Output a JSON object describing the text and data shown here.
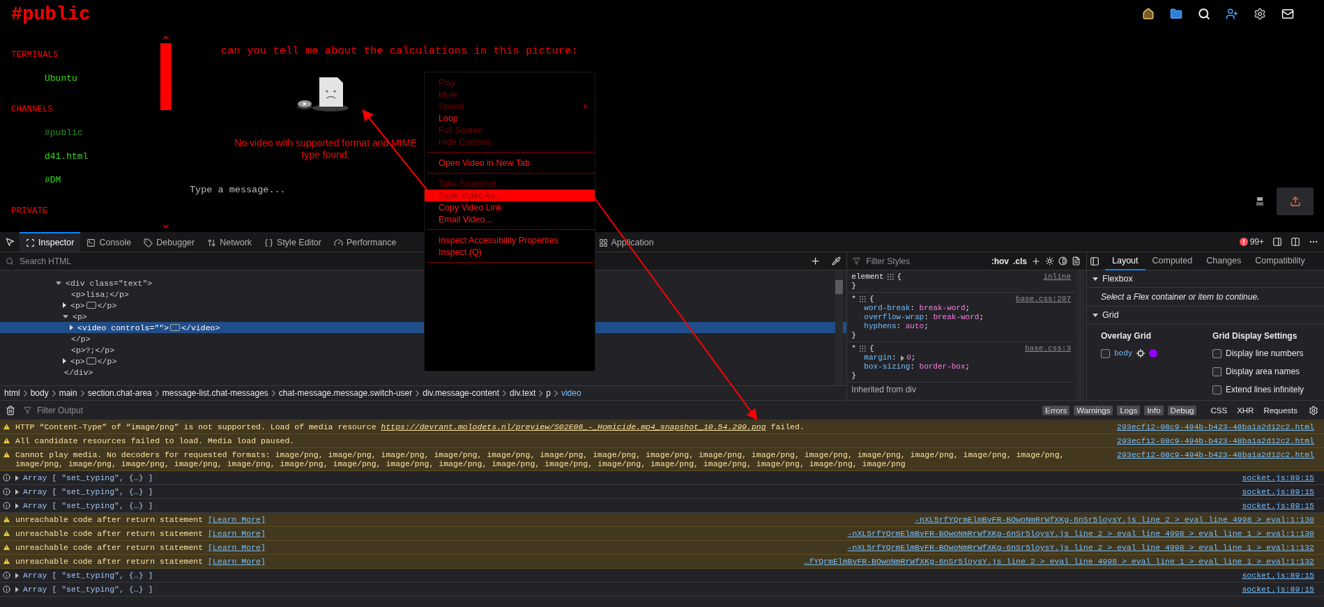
{
  "chat": {
    "sidebar": {
      "title": "#public",
      "sections": [
        {
          "heading": "TERMINALS",
          "items": [
            {
              "label": "Ubuntu",
              "selected": false
            }
          ]
        },
        {
          "heading": "CHANNELS",
          "items": [
            {
              "label": "#public",
              "selected": true
            },
            {
              "label": "d41.html",
              "selected": false
            },
            {
              "label": "#DM",
              "selected": false
            }
          ]
        },
        {
          "heading": "PRIVATE"
        }
      ]
    },
    "message": "can you tell me about the calculations in this picture:",
    "video_error": "No video with supported format and MIME type found.",
    "input": {
      "placeholder": "Type a message..."
    }
  },
  "context_menu": {
    "groups": [
      {
        "items": [
          {
            "label": "Play",
            "disabled": true,
            "selected": false,
            "submenu": false
          },
          {
            "label": "Mute",
            "disabled": true,
            "selected": false,
            "submenu": false
          },
          {
            "label": "Speed",
            "disabled": true,
            "selected": false,
            "submenu": true
          },
          {
            "label": "Loop",
            "disabled": false,
            "selected": false,
            "submenu": false
          },
          {
            "label": "Full Screen",
            "disabled": true,
            "selected": false,
            "submenu": false
          },
          {
            "label": "Hide Controls",
            "disabled": true,
            "selected": false,
            "submenu": false
          }
        ]
      },
      {
        "items": [
          {
            "label": "Open Video in New Tab",
            "disabled": false,
            "selected": false,
            "submenu": false
          }
        ]
      },
      {
        "items": [
          {
            "label": "Take Snapshot...",
            "disabled": true,
            "selected": false,
            "submenu": false
          },
          {
            "label": "Save Video As...",
            "disabled": false,
            "selected": true,
            "submenu": false
          },
          {
            "label": "Copy Video Link",
            "disabled": false,
            "selected": false,
            "submenu": false
          },
          {
            "label": "Email Video...",
            "disabled": false,
            "selected": false,
            "submenu": false
          }
        ]
      },
      {
        "items": [
          {
            "label": "Inspect Accessibility Properties",
            "disabled": false,
            "selected": false,
            "submenu": false
          },
          {
            "label": "Inspect (Q)",
            "disabled": false,
            "selected": false,
            "submenu": false
          }
        ]
      }
    ]
  },
  "devtools": {
    "tabs": [
      {
        "label": "Inspector",
        "selected": true
      },
      {
        "label": "Console",
        "selected": false
      },
      {
        "label": "Debugger",
        "selected": false
      },
      {
        "label": "Network",
        "selected": false
      },
      {
        "label": "Style Editor",
        "selected": false
      },
      {
        "label": "Performance",
        "selected": false
      },
      {
        "label": "Application",
        "selected": false
      }
    ],
    "error_count": "99+",
    "markup": {
      "search_placeholder": "Search HTML",
      "nodes": [
        {
          "kind": "element",
          "tag": "<div class=\"text\">",
          "close": "</div>",
          "expanded": true,
          "selected": false,
          "children": [
            {
              "kind": "text",
              "tag": "<p>lisa;</p>",
              "selected": false
            },
            {
              "kind": "element",
              "tag": "<p>",
              "close": "</p>",
              "expanded": false,
              "selected": false
            },
            {
              "kind": "element",
              "tag": "<p>",
              "close": "</p>",
              "expanded": true,
              "selected": false,
              "children": [
                {
                  "kind": "element",
                  "tag": "<video controls=\"\">",
                  "close": "</video>",
                  "expanded": false,
                  "selected": true
                }
              ]
            },
            {
              "kind": "text",
              "tag": "<p>?;</p>",
              "selected": false
            },
            {
              "kind": "element",
              "tag": "<p>",
              "close": "</p>",
              "expanded": false,
              "selected": false
            }
          ]
        }
      ],
      "breadcrumbs": [
        {
          "label": "html",
          "selected": false
        },
        {
          "label": "body",
          "selected": false
        },
        {
          "label": "main",
          "selected": false
        },
        {
          "label": "section.chat-area",
          "selected": false
        },
        {
          "label": "message-list.chat-messages",
          "selected": false
        },
        {
          "label": "chat-message.message.switch-user",
          "selected": false
        },
        {
          "label": "div.message-content",
          "selected": false
        },
        {
          "label": "div.text",
          "selected": false
        },
        {
          "label": "p",
          "selected": false
        },
        {
          "label": "video",
          "selected": true
        }
      ]
    },
    "rules": {
      "filter_placeholder": "Filter Styles",
      "toggles": [
        ":hov",
        ".cls"
      ],
      "rules": [
        {
          "selector": "element",
          "open": "{",
          "close": "}",
          "source": "inline"
        },
        {
          "selector": "*",
          "open": "{",
          "close": "}",
          "source": "base.css:207",
          "declarations": [
            {
              "property": "word-break",
              "colon": ":",
              "value": "break-word",
              "end": ";",
              "expandable": false
            },
            {
              "property": "overflow-wrap",
              "colon": ":",
              "value": "break-word",
              "end": ";",
              "expandable": false
            },
            {
              "property": "hyphens",
              "colon": ":",
              "value": "auto",
              "end": ";",
              "expandable": false
            }
          ]
        },
        {
          "selector": "*",
          "open": "{",
          "close": "}",
          "source": "base.css:3",
          "declarations": [
            {
              "property": "margin",
              "colon": ":",
              "value": "0",
              "end": ";",
              "expandable": true
            },
            {
              "property": "box-sizing",
              "colon": ":",
              "value": "border-box",
              "end": ";",
              "expandable": false
            }
          ]
        }
      ],
      "inherited_heading": "Inherited from div"
    },
    "layout": {
      "tabs": [
        {
          "label": "Layout",
          "selected": true
        },
        {
          "label": "Computed",
          "selected": false
        },
        {
          "label": "Changes",
          "selected": false
        },
        {
          "label": "Compatibility",
          "selected": false
        }
      ],
      "flexbox": {
        "title": "Flexbox",
        "expanded": true,
        "message": "Select a Flex container or item to continue."
      },
      "grid": {
        "title": "Grid",
        "expanded": true,
        "overlay_title": "Overlay Grid",
        "overlays": [
          {
            "label": "body",
            "checked": false,
            "color": "#9400ff"
          }
        ],
        "settings_title": "Grid Display Settings",
        "settings": [
          {
            "label": "Display line numbers",
            "checked": false
          },
          {
            "label": "Display area names",
            "checked": false
          },
          {
            "label": "Extend lines infinitely",
            "checked": false
          }
        ]
      }
    },
    "console": {
      "filter_placeholder": "Filter Output",
      "filters": [
        {
          "label": "Errors",
          "selected": true
        },
        {
          "label": "Warnings",
          "selected": true
        },
        {
          "label": "Logs",
          "selected": true
        },
        {
          "label": "Info",
          "selected": true
        },
        {
          "label": "Debug",
          "selected": true
        },
        {
          "label": "CSS",
          "selected": false
        },
        {
          "label": "XHR",
          "selected": false
        },
        {
          "label": "Requests",
          "selected": false
        }
      ],
      "messages": [
        {
          "kind": "warning",
          "text": "HTTP “Content-Type” of “image/png” is not supported. Load of media resource ",
          "url": "https://devrant.molodets.nl/preview/S02E06_-_Homicide.mp4_snapshot_10.54.299.png",
          "text_end": " failed.",
          "source": "293ecf12-08c9-494b-b423-48ba1a2d12c2.html"
        },
        {
          "kind": "warning",
          "text": "All candidate resources failed to load. Media load paused.",
          "source": "293ecf12-08c9-494b-b423-48ba1a2d12c2.html"
        },
        {
          "kind": "warning",
          "text": "Cannot play media. No decoders for requested formats: image/png, image/png, image/png, image/png, image/png, image/png, image/png, image/png, image/png, image/png, image/png, image/png, image/png, image/png, image/png, image/png, image/png, image/png, image/png, image/png, image/png, image/png, image/png, image/png, image/png, image/png, image/png, image/png, image/png, image/png, image/png, image/png",
          "source": "293ecf12-08c9-494b-b423-48ba1a2d12c2.html"
        },
        {
          "kind": "log",
          "text": "Array [ \"set_typing\", {…} ]",
          "source": "socket.js:89:15"
        },
        {
          "kind": "log",
          "text": "Array [ \"set_typing\", {…} ]",
          "source": "socket.js:89:15"
        },
        {
          "kind": "log",
          "text": "Array [ \"set_typing\", {…} ]",
          "source": "socket.js:89:15"
        },
        {
          "kind": "warning",
          "text": "unreachable code after return statement ",
          "link": "[Learn More]",
          "source": "-nXL5rfYQrmElmBvFR-BOwoNmRrWfXKg-6nSr5loysY.js line 2 > eval line 4998 > eval:1:130"
        },
        {
          "kind": "warning",
          "text": "unreachable code after return statement ",
          "link": "[Learn More]",
          "source": "-nXL5rfYQrmElmBvFR-BOwoNmRrWfXKg-6nSr5loysY.js line 2 > eval line 4998 > eval line 1 > eval:1:130"
        },
        {
          "kind": "warning",
          "text": "unreachable code after return statement ",
          "link": "[Learn More]",
          "source": "-nXL5rfYQrmElmBvFR-BOwoNmRrWfXKg-6nSr5loysY.js line 2 > eval line 4998 > eval line 1 > eval:1:132"
        },
        {
          "kind": "warning",
          "text": "unreachable code after return statement ",
          "link": "[Learn More]",
          "source": "…fYQrmElmBvFR-BOwoNmRrWfXKg-6nSr5loysY.js line 2 > eval line 4998 > eval line 1 > eval line 1 > eval:1:132"
        },
        {
          "kind": "log",
          "text": "Array [ \"set_typing\", {…} ]",
          "source": "socket.js:89:15"
        },
        {
          "kind": "log",
          "text": "Array [ \"set_typing\", {…} ]",
          "source": "socket.js:89:15"
        }
      ]
    }
  }
}
